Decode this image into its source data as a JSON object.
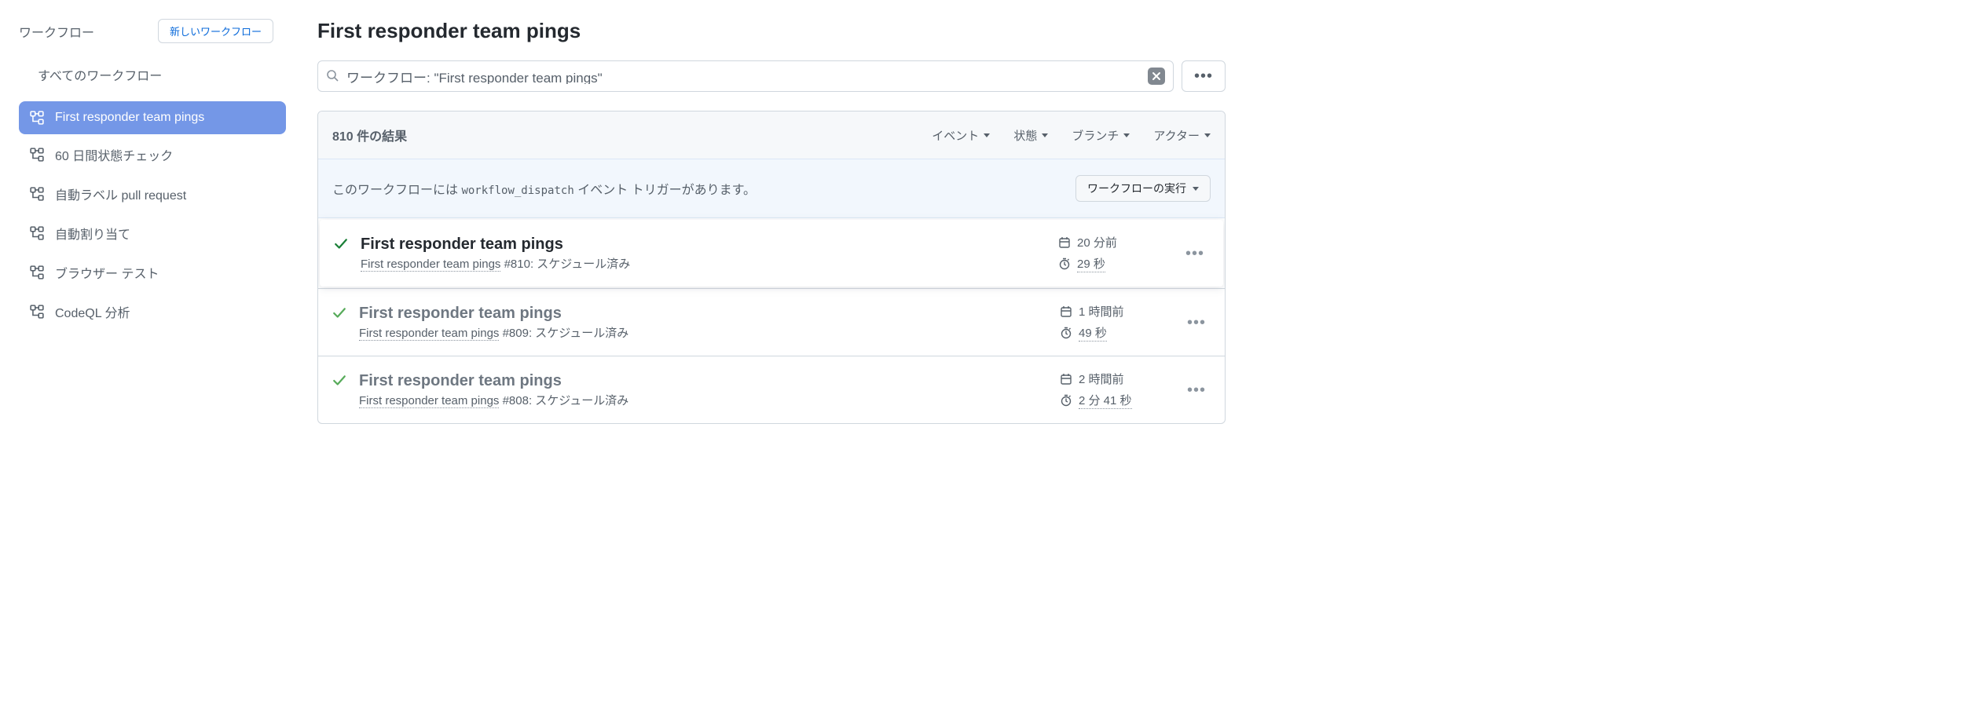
{
  "sidebar": {
    "title": "ワークフロー",
    "new_button": "新しいワークフロー",
    "all_label": "すべてのワークフロー",
    "items": [
      {
        "label": "First responder team pings",
        "active": true
      },
      {
        "label": "60 日間状態チェック",
        "active": false
      },
      {
        "label": "自動ラベル pull request",
        "active": false
      },
      {
        "label": "自動割り当て",
        "active": false
      },
      {
        "label": "ブラウザー テスト",
        "active": false
      },
      {
        "label": "CodeQL 分析",
        "active": false
      }
    ]
  },
  "main": {
    "title": "First responder team pings",
    "filter_value": "ワークフロー: \"First responder team pings\"",
    "results_count": "810 件の結果",
    "filters": {
      "event": "イベント",
      "status": "状態",
      "branch": "ブランチ",
      "actor": "アクター"
    },
    "dispatch": {
      "prefix": "このワークフローには ",
      "code": "workflow_dispatch",
      "suffix": " イベント トリガーがあります。",
      "button": "ワークフローの実行"
    },
    "runs": [
      {
        "title": "First responder team pings",
        "subtitle_prefix": "First responder team pings",
        "subtitle_run": " #810: スケジュール済み",
        "time": "20 分前",
        "duration": "29 秒",
        "highlighted": true
      },
      {
        "title": "First responder team pings",
        "subtitle_prefix": "First responder team pings",
        "subtitle_run": " #809: スケジュール済み",
        "time": "1 時間前",
        "duration": "49 秒",
        "highlighted": false
      },
      {
        "title": "First responder team pings",
        "subtitle_prefix": "First responder team pings",
        "subtitle_run": " #808: スケジュール済み",
        "time": "2 時間前",
        "duration": "2 分 41 秒",
        "highlighted": false
      }
    ]
  }
}
